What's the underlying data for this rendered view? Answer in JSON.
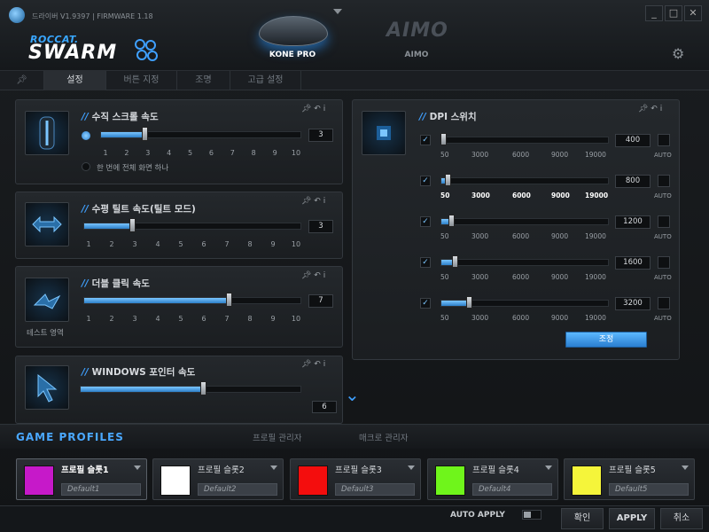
{
  "window": {
    "version": "드라이버 V1.9397 | FIRMWARE 1.18",
    "min": "_",
    "max": "□",
    "close": "✕"
  },
  "brand": {
    "roccat": "ROCCAT.",
    "swarm": "SWARM"
  },
  "devices": [
    {
      "name": "KONE PRO"
    },
    {
      "name": "AIMO",
      "logo": "AIMO"
    }
  ],
  "tabs": [
    "설정",
    "버튼 지정",
    "조명",
    "고급 설정"
  ],
  "panels": {
    "vscroll": {
      "title": "수직 스크롤 속도",
      "value": "3",
      "level": 0.2222,
      "ticks": [
        "1",
        "2",
        "3",
        "4",
        "5",
        "6",
        "7",
        "8",
        "9",
        "10"
      ],
      "option": "한 번에 전체 화면 하나"
    },
    "htilt": {
      "title": "수평 틸트 속도(틸트 모드)",
      "value": "3",
      "level": 0.2222,
      "ticks": [
        "1",
        "2",
        "3",
        "4",
        "5",
        "6",
        "7",
        "8",
        "9",
        "10"
      ]
    },
    "dblclick": {
      "title": "더블 클릭 속도",
      "value": "7",
      "level": 0.6667,
      "ticks": [
        "1",
        "2",
        "3",
        "4",
        "5",
        "6",
        "7",
        "8",
        "9",
        "10"
      ],
      "test_area": "테스트 영역"
    },
    "pointer": {
      "title_strong": "WINDOWS",
      "title_rest": " 포인터 속도",
      "value": "6",
      "level": 0.5556
    }
  },
  "dpi": {
    "title": "DPI 스위치",
    "ticks": [
      "50",
      "3000",
      "6000",
      "9000",
      "19000"
    ],
    "auto_label": "AUTO",
    "rows": [
      {
        "value": "400",
        "checked": true,
        "level": 0.018
      },
      {
        "value": "800",
        "checked": true,
        "level": 0.04
      },
      {
        "value": "1200",
        "checked": true,
        "level": 0.061
      },
      {
        "value": "1600",
        "checked": true,
        "level": 0.082
      },
      {
        "value": "3200",
        "checked": true,
        "level": 0.166
      }
    ],
    "adjust": "조정"
  },
  "profiles": {
    "title": "GAME PROFILES",
    "tabs": [
      "프로필 관리자",
      "매크로 관리자"
    ],
    "slots": [
      {
        "name": "프로필 슬롯1",
        "default": "Default1",
        "color": "#c619c9"
      },
      {
        "name": "프로필 슬롯2",
        "default": "Default2",
        "color": "#ffffff"
      },
      {
        "name": "프로필 슬롯3",
        "default": "Default3",
        "color": "#f40d0d"
      },
      {
        "name": "프로필 슬롯4",
        "default": "Default4",
        "color": "#6ff51b"
      },
      {
        "name": "프로필 슬롯5",
        "default": "Default5",
        "color": "#f5f53a"
      }
    ]
  },
  "footer": {
    "auto_apply": "AUTO APPLY",
    "ok": "확인",
    "apply": "APPLY",
    "cancel": "취소"
  },
  "colors": {
    "accent": "#3fa0ff"
  }
}
